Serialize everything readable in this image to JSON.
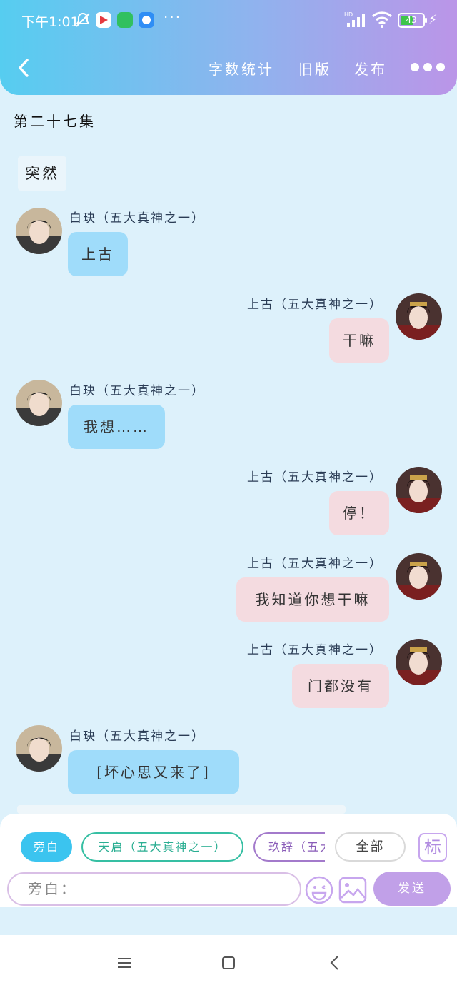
{
  "status_bar": {
    "time": "下午1:01",
    "icons": [
      "mute-bell-icon",
      "video-app-icon",
      "green-app-icon",
      "blue-app-icon",
      "more-icon",
      "hd-signal-icon",
      "wifi-icon"
    ],
    "battery": "43",
    "more": "···"
  },
  "nav": {
    "word_count": "字数统计",
    "old_version": "旧版",
    "publish": "发布"
  },
  "colors": {
    "header_gradient": [
      "#56cdf0",
      "#bb95e8"
    ],
    "page_bg": "#ddf1fb",
    "left_bubble": "#9fdcfa",
    "right_bubble": "#f4dbe0",
    "send_button": "#c1a0e8"
  },
  "episode_title": "第二十七集",
  "narration": "突然",
  "messages": [
    {
      "side": "left",
      "name": "白玦（五大真神之一）",
      "text": "上古"
    },
    {
      "side": "right",
      "name": "上古（五大真神之一）",
      "text": "干嘛"
    },
    {
      "side": "left",
      "name": "白玦（五大真神之一）",
      "text": "我想……"
    },
    {
      "side": "right",
      "name": "上古（五大真神之一）",
      "text": "停！"
    },
    {
      "side": "right",
      "name": "上古（五大真神之一）",
      "text": "我知道你想干嘛"
    },
    {
      "side": "right",
      "name": "上古（五大真神之一）",
      "text": "门都没有"
    },
    {
      "side": "left",
      "name": "白玦（五大真神之一）",
      "text": "[坏心思又来了]"
    }
  ],
  "composer": {
    "chips": [
      "旁白",
      "天启（五大真神之一）",
      "玖辞（五大真神之一）",
      "全部"
    ],
    "tag_label": "标",
    "input_placeholder": "旁白：",
    "send_label": "发送"
  }
}
